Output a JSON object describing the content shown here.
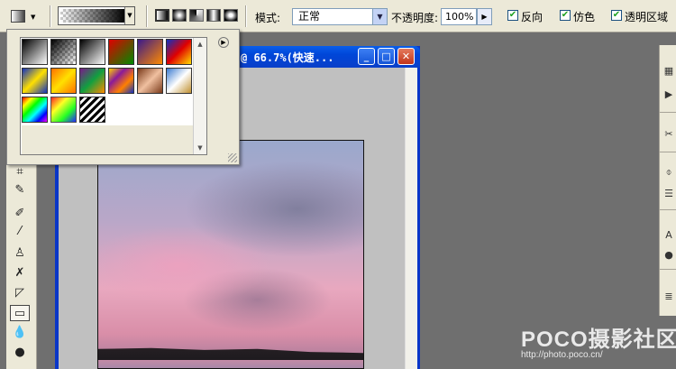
{
  "options_bar": {
    "mode_label": "模式:",
    "mode_value": "正常",
    "opacity_label": "不透明度:",
    "opacity_value": "100%",
    "reverse_label": "反向",
    "dither_label": "仿色",
    "transparency_label": "透明区域",
    "reverse_checked": true,
    "dither_checked": true,
    "transparency_checked": true,
    "gradient_types": [
      "linear-gradient-icon",
      "radial-gradient-icon",
      "angle-gradient-icon",
      "reflected-gradient-icon",
      "diamond-gradient-icon"
    ],
    "selected_gradient_type": "linear-gradient-icon"
  },
  "document": {
    "title": "@ 66.7%(快速...",
    "zoom": "66.7%",
    "buttons": [
      "minimize-icon",
      "maximize-icon",
      "close-icon"
    ]
  },
  "gradient_presets": {
    "rows": 3,
    "swatches": [
      {
        "name": "black-white",
        "colors": [
          "#000000",
          "#ffffff"
        ]
      },
      {
        "name": "foreground-transparent",
        "colors": [
          "#000000",
          "transparent"
        ]
      },
      {
        "name": "black-white-2",
        "colors": [
          "#000000",
          "#ffffff"
        ]
      },
      {
        "name": "red-green",
        "colors": [
          "#e00000",
          "#008a00"
        ]
      },
      {
        "name": "violet-orange",
        "colors": [
          "#3a1a8a",
          "#ff8a00"
        ]
      },
      {
        "name": "blue-red-yellow",
        "colors": [
          "#1030c0",
          "#e00000",
          "#ffe000"
        ]
      },
      {
        "name": "blue-yellow-blue",
        "colors": [
          "#1030c0",
          "#ffe000",
          "#1030c0"
        ]
      },
      {
        "name": "orange-yellow-orange",
        "colors": [
          "#ff7000",
          "#ffe000",
          "#ff7000"
        ]
      },
      {
        "name": "violet-green-orange",
        "colors": [
          "#7a1a8a",
          "#10a040",
          "#ff8a00"
        ]
      },
      {
        "name": "yellow-violet-orange-blue",
        "colors": [
          "#ffd000",
          "#8a1a9a",
          "#ff8000",
          "#1030c0"
        ]
      },
      {
        "name": "copper",
        "colors": [
          "#7a3a1a",
          "#f0c0a0",
          "#7a3a1a"
        ]
      },
      {
        "name": "chrome",
        "colors": [
          "#3a7ad0",
          "#ffffff",
          "#c09030"
        ]
      },
      {
        "name": "spectrum",
        "colors": [
          "#ff0000",
          "#ffff00",
          "#00ff00",
          "#00ffff",
          "#0000ff",
          "#ff00ff"
        ]
      },
      {
        "name": "transparent-rainbow",
        "colors": [
          "#ff0000",
          "#ffff00",
          "#00ff00",
          "#0000ff"
        ]
      },
      {
        "name": "transparent-stripes",
        "colors": [
          "#000000",
          "#ffffff"
        ]
      }
    ]
  },
  "toolbox": {
    "tools": [
      "crop-icon",
      "slice-icon",
      "healing-brush-icon",
      "brush-icon",
      "clone-stamp-icon",
      "history-brush-icon",
      "eraser-icon",
      "gradient-icon",
      "blur-icon",
      "dodge-icon"
    ],
    "active_tool": "gradient-icon"
  },
  "right_strip": {
    "icons": [
      "palette-icon",
      "play-icon",
      "tools-icon",
      "brush-preset-icon",
      "layers-icon",
      "text-icon",
      "dot-icon",
      "paragraph-icon"
    ]
  },
  "watermark": {
    "brand": "POCO摄影社区",
    "url": "http://photo.poco.cn/"
  }
}
